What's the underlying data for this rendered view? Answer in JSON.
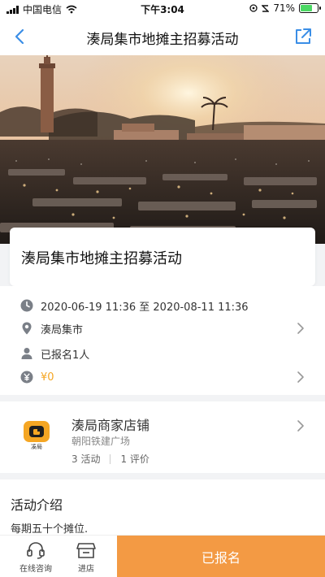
{
  "status_bar": {
    "carrier": "中国电信",
    "time": "下午3:04",
    "battery_text": "71%",
    "battery_level": 0.71
  },
  "nav": {
    "title": "湊局集市地摊主招募活动"
  },
  "event": {
    "title": "湊局集市地摊主招募活动",
    "time_range": "2020-06-19 11:36 至 2020-08-11 11:36",
    "location": "湊局集市",
    "signup": "已报名1人",
    "price": "¥0"
  },
  "shop": {
    "name": "湊局商家店铺",
    "address": "朝阳铁建广场",
    "activities": "3 活动",
    "reviews": "1 评价",
    "logo_text": "凑局",
    "logo_color": "#f5a623"
  },
  "intro": {
    "title": "活动介绍",
    "text": "每期五十个摊位."
  },
  "bottom": {
    "consult_label": "在线咨询",
    "store_label": "进店",
    "cta_label": "已报名",
    "cta_color": "#f39a44"
  }
}
